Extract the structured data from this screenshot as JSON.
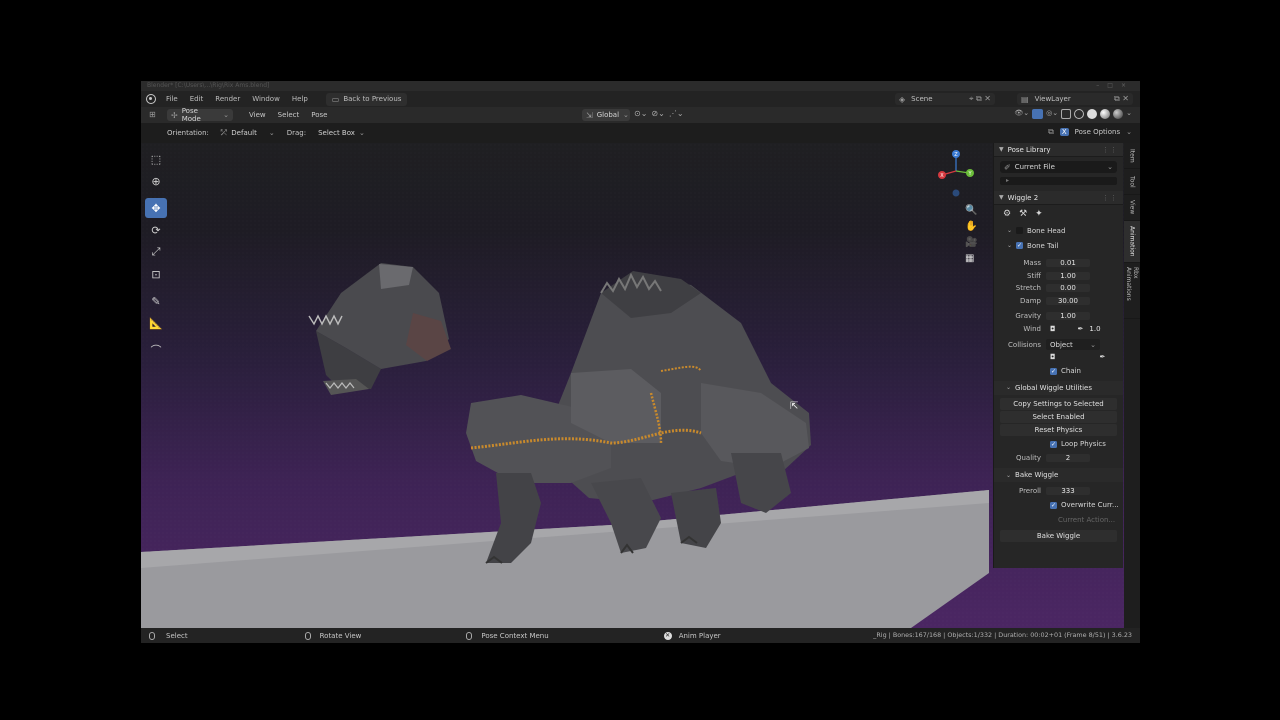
{
  "titlebar": {
    "text": "Blender* [C:\\Users\\...\\Rig\\Rix Ams.blend]"
  },
  "menu": {
    "items": [
      "File",
      "Edit",
      "Render",
      "Window",
      "Help"
    ],
    "back_label": "Back to Previous",
    "scene_label": "Scene",
    "viewlayer_label": "ViewLayer"
  },
  "header": {
    "mode_label": "Pose Mode",
    "items": [
      "View",
      "Select",
      "Pose"
    ],
    "orientation_value": "Global"
  },
  "toolsettings": {
    "orientation_label": "Orientation:",
    "orientation_value": "Default",
    "drag_label": "Drag:",
    "drag_value": "Select Box",
    "pose_options_label": "Pose Options"
  },
  "gizmo": {
    "z": "Z",
    "y": "Y",
    "x": "X"
  },
  "npanel": {
    "pose_library": {
      "title": "Pose Library",
      "dropdown": "Current File",
      "subline": "▸"
    },
    "wiggle": {
      "title": "Wiggle 2",
      "bone_head": "Bone Head",
      "bone_tail": "Bone Tail",
      "props": [
        {
          "label": "Mass",
          "value": "0.01"
        },
        {
          "label": "Stiff",
          "value": "1.00"
        },
        {
          "label": "Stretch",
          "value": "0.00"
        },
        {
          "label": "Damp",
          "value": "30.00"
        },
        {
          "label": "Gravity",
          "value": "1.00"
        }
      ],
      "wind_label": "Wind",
      "wind_value": "1.0",
      "collisions_label": "Collisions",
      "collisions_value": "Object",
      "chain_label": "Chain"
    },
    "global_utils": {
      "title": "Global Wiggle Utilities",
      "copy_btn": "Copy Settings to Selected",
      "select_btn": "Select Enabled",
      "reset_btn": "Reset Physics",
      "loop_label": "Loop Physics",
      "quality_label": "Quality",
      "quality_value": "2"
    },
    "bake": {
      "title": "Bake Wiggle",
      "preroll_label": "Preroll",
      "preroll_value": "333",
      "overwrite_label": "Overwrite Curr...",
      "current_action": "Current Action...",
      "bake_btn": "Bake Wiggle"
    }
  },
  "sidetabs": [
    "Item",
    "Tool",
    "View",
    "Animation",
    "Rbx Animations"
  ],
  "statusbar": {
    "select": "Select",
    "rotate": "Rotate View",
    "context": "Pose Context Menu",
    "anim_player": "Anim Player",
    "stats": "_Rig | Bones:167/168 | Objects:1/332 | Duration: 00:02+01 (Frame 8/51) | 3.6.23"
  }
}
